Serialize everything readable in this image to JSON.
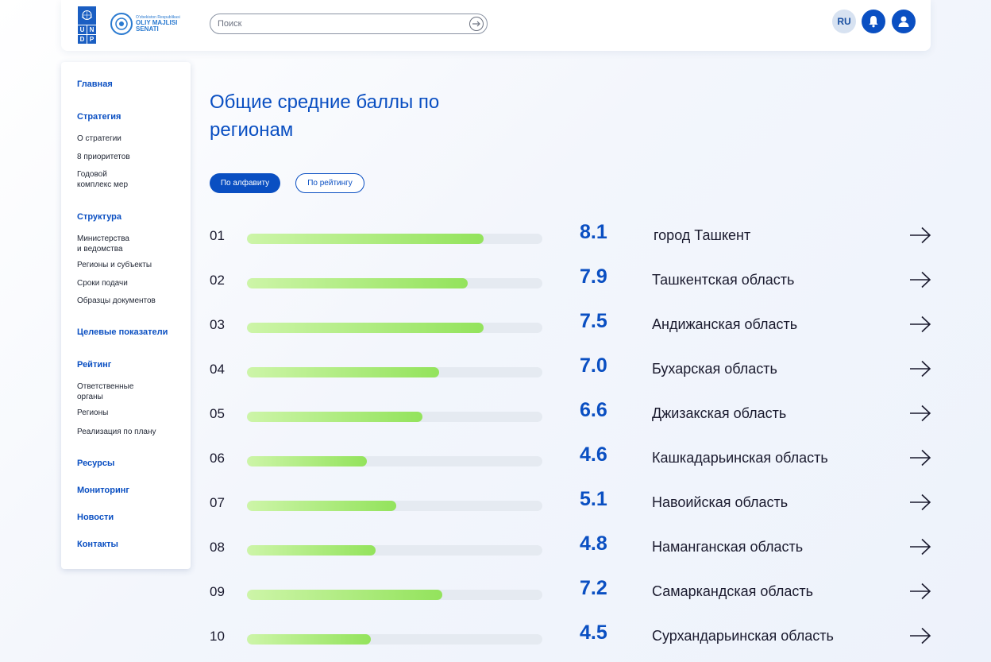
{
  "header": {
    "undp_letters": [
      "U",
      "N",
      "D",
      "P"
    ],
    "senate_small": "O'zbekiston Respublikasi",
    "senate_line1": "OLIY MAJLISI",
    "senate_line2": "SENATI",
    "search_placeholder": "Поиск",
    "lang": "RU"
  },
  "sidebar": {
    "main": "Главная",
    "strategy": "Стратегия",
    "strategy_items": [
      "О стратегии",
      "8 приоритетов",
      "Годовой\nкомплекс мер"
    ],
    "structure": "Структура",
    "structure_items": [
      "Министерства\nи ведомства",
      "Регионы и субъекты",
      "Сроки подачи",
      "Образцы документов"
    ],
    "targets": "Целевые показатели",
    "rating": "Рейтинг",
    "rating_items": [
      "Ответственные\nорганы",
      "Регионы",
      "Реализация по плану"
    ],
    "resources": "Ресурсы",
    "monitoring": "Мониторинг",
    "news": "Новости",
    "contacts": "Контакты"
  },
  "main": {
    "title": "Общие средние баллы по регионам",
    "filter_alpha": "По алфавиту",
    "filter_rating": "По рейтингу"
  },
  "regions": [
    {
      "num": "01",
      "score": "8.1",
      "fill": 0.8,
      "name": "город Ташкент"
    },
    {
      "num": "02",
      "score": "7.9",
      "fill": 0.746,
      "name": "Ташкентская область"
    },
    {
      "num": "03",
      "score": "7.5",
      "fill": 0.8,
      "name": "Андижанская область"
    },
    {
      "num": "04",
      "score": "7.0",
      "fill": 0.65,
      "name": "Бухарская область"
    },
    {
      "num": "05",
      "score": "6.6",
      "fill": 0.595,
      "name": "Джизакская область"
    },
    {
      "num": "06",
      "score": "4.6",
      "fill": 0.407,
      "name": "Кашкадарьинская область"
    },
    {
      "num": "07",
      "score": "5.1",
      "fill": 0.505,
      "name": "Навоийская область"
    },
    {
      "num": "08",
      "score": "4.8",
      "fill": 0.435,
      "name": "Наманганская область"
    },
    {
      "num": "09",
      "score": "7.2",
      "fill": 0.662,
      "name": "Самаркандская область"
    },
    {
      "num": "10",
      "score": "4.5",
      "fill": 0.42,
      "name": "Сурхандарьинская область"
    }
  ],
  "colors": {
    "accent": "#0a4fc2",
    "bar_start": "#cdf5a8",
    "bar_end": "#93e35c",
    "track": "#e5eaf1"
  }
}
